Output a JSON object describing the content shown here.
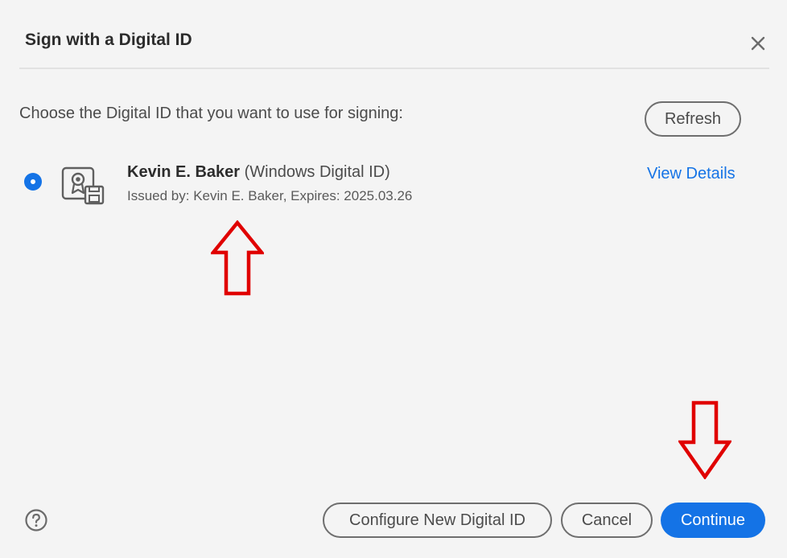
{
  "dialog": {
    "title": "Sign with a Digital ID",
    "close_icon": "close-icon"
  },
  "prompt": "Choose the Digital ID that you want to use for signing:",
  "refresh_label": "Refresh",
  "digital_id": {
    "selected": true,
    "icon": "digital-id-certificate-icon",
    "name": "Kevin E. Baker",
    "type": "(Windows Digital ID)",
    "issued_by_line": "Issued by: Kevin E. Baker, Expires: 2025.03.26",
    "view_details_label": "View Details"
  },
  "annotations": {
    "arrow_color": "#e00000"
  },
  "footer": {
    "help_icon": "help-icon",
    "configure_label": "Configure New Digital ID",
    "cancel_label": "Cancel",
    "continue_label": "Continue"
  },
  "colors": {
    "accent": "#1473e6",
    "dialog_background": "#f4f4f4"
  }
}
